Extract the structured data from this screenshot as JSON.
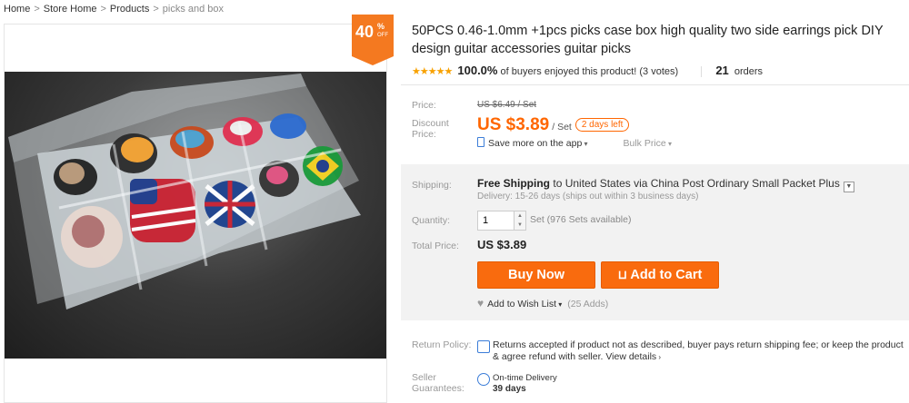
{
  "breadcrumb": {
    "items": [
      "Home",
      "Store Home",
      "Products"
    ],
    "current": "picks and box",
    "separator": ">"
  },
  "discount_badge": {
    "number": "40",
    "percent": "%",
    "off": "OFF",
    "color": "#f47920"
  },
  "product": {
    "title": "50PCS 0.46-1.0mm +1pcs picks case box high quality two side earrings pick DIY design guitar accessories guitar picks",
    "rating_percent": "100.0%",
    "rating_text": "of buyers enjoyed this product! (3 votes)",
    "orders_count": "21",
    "orders_label": "orders"
  },
  "pricing": {
    "price_label": "Price:",
    "original_price": "US $6.49 / Set",
    "discount_label": "Discount Price:",
    "discount_price": "US $3.89",
    "per_unit": "/ Set",
    "days_left": "2 days left",
    "save_app": "Save more on the app",
    "bulk_price": "Bulk Price",
    "accent_color": "#ff6600"
  },
  "shipping": {
    "label": "Shipping:",
    "free": "Free Shipping",
    "to": "to United States via China Post Ordinary Small Packet Plus",
    "delivery": "Delivery: 15-26 days (ships out within 3 business days)"
  },
  "quantity": {
    "label": "Quantity:",
    "value": "1",
    "available": "Set (976 Sets available)"
  },
  "total": {
    "label": "Total Price:",
    "value": "US $3.89"
  },
  "actions": {
    "buy_now": "Buy Now",
    "add_to_cart": "Add to Cart",
    "wish_list": "Add to Wish List",
    "adds": "(25 Adds)"
  },
  "return_policy": {
    "label": "Return Policy:",
    "text": "Returns accepted if product not as described, buyer pays return shipping fee; or keep the product & agree refund with seller.",
    "view_details": "View details"
  },
  "guarantees": {
    "label": "Seller Guarantees:",
    "title": "On-time Delivery",
    "days": "39 days"
  }
}
